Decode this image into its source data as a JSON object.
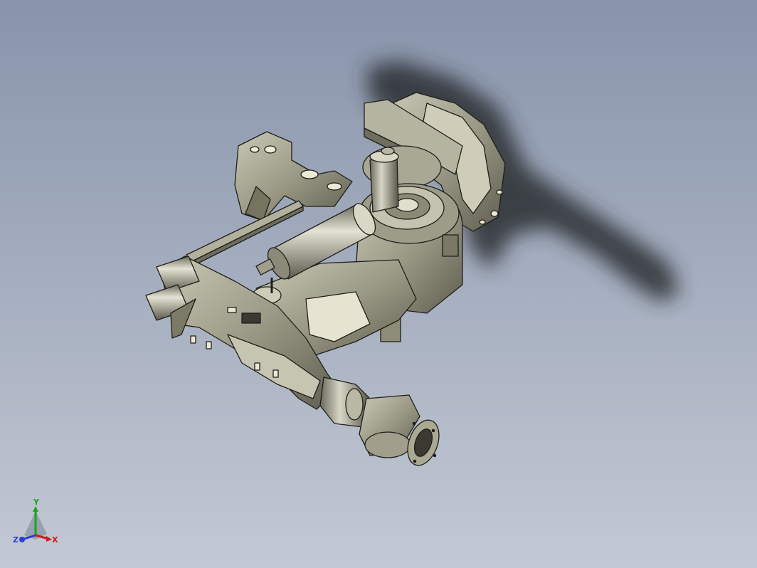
{
  "viewport": {
    "background_top": "#8894ab",
    "background_bottom": "#c3c9d4",
    "model_color": "#9b9a86",
    "model_edge_color": "#1e1e1a",
    "shadow_color": "#2a2d33"
  },
  "triad": {
    "x_label": "X",
    "y_label": "Y",
    "z_label": "Z",
    "x_color": "#d01c1c",
    "y_color": "#1aa51a",
    "z_color": "#2a3cd8"
  }
}
